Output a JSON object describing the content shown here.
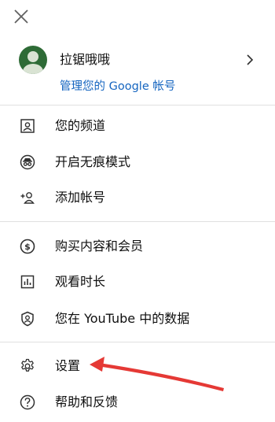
{
  "account": {
    "name": "拉锯哦哦",
    "manage_link": "管理您的 Google 帐号"
  },
  "menu_group_1": [
    {
      "label": "您的频道",
      "icon": "channel-icon"
    },
    {
      "label": "开启无痕模式",
      "icon": "incognito-icon"
    },
    {
      "label": "添加帐号",
      "icon": "add-account-icon"
    }
  ],
  "menu_group_2": [
    {
      "label": "购买内容和会员",
      "icon": "dollar-icon"
    },
    {
      "label": "观看时长",
      "icon": "bar-chart-icon"
    },
    {
      "label": "您在 YouTube 中的数据",
      "icon": "shield-person-icon"
    }
  ],
  "menu_group_3": [
    {
      "label": "设置",
      "icon": "gear-icon"
    },
    {
      "label": "帮助和反馈",
      "icon": "help-icon"
    }
  ],
  "colors": {
    "link": "#1565c0",
    "avatar": "#2e6b36",
    "annotation_arrow": "#e53935",
    "divider": "#e0e0e0"
  }
}
